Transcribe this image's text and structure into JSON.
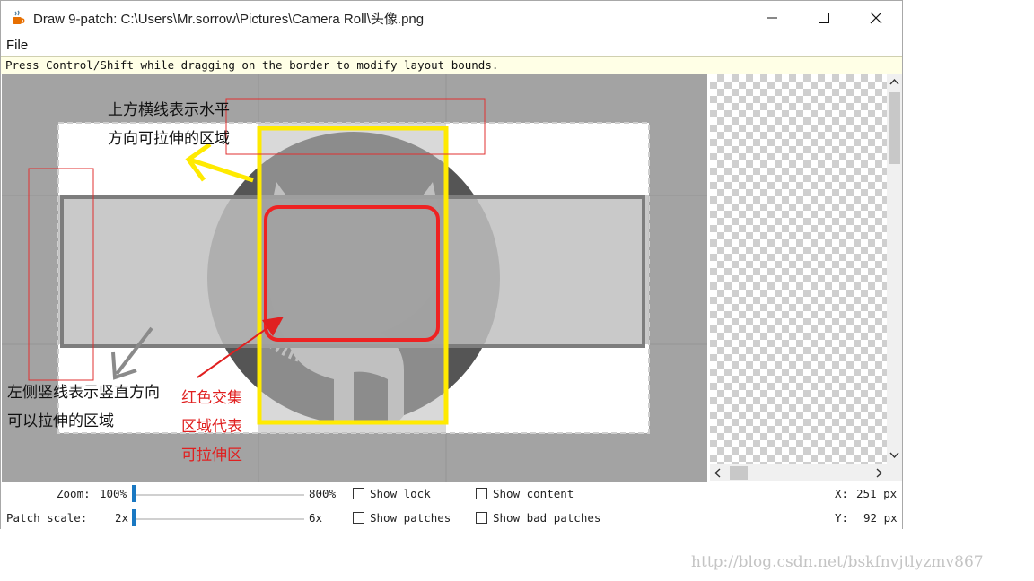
{
  "window": {
    "title": "Draw 9-patch: C:\\Users\\Mr.sorrow\\Pictures\\Camera Roll\\头像.png",
    "app_icon": "java-coffee-icon",
    "minimize_icon": "minimize-icon",
    "maximize_icon": "maximize-icon",
    "close_icon": "close-icon"
  },
  "menu": {
    "items": [
      "File"
    ]
  },
  "hint": "Press Control/Shift while dragging on the border to modify layout bounds.",
  "annotations": {
    "top_line1": "上方横线表示水平",
    "top_line2": "方向可拉伸的区域",
    "left_line1": "左侧竖线表示竖直方向",
    "left_line2": "可以拉伸的区域",
    "red_line1": "红色交集",
    "red_line2": "区域代表",
    "red_line3": "可拉伸区"
  },
  "colors": {
    "yellow": "#ffea00",
    "red_annotation": "#e02020",
    "red_box": "#ee2222",
    "canvas_bg": "#a3a3a3",
    "slider": "#1a78c2"
  },
  "controls": {
    "zoom_label": "Zoom:",
    "zoom_value": "100%",
    "zoom_max": "800%",
    "zoom_level": 0.0,
    "patch_label": "Patch scale:",
    "patch_value": "2x",
    "patch_max": "6x",
    "patch_level": 0.0,
    "show_lock": "Show lock",
    "show_content": "Show content",
    "show_patches": "Show patches",
    "show_bad_patches": "Show bad patches",
    "x_label": "X:",
    "x_value": "251 px",
    "y_label": "Y:",
    "y_value": "92 px"
  },
  "watermark": "http://blog.csdn.net/bskfnvjtlyzmv867"
}
